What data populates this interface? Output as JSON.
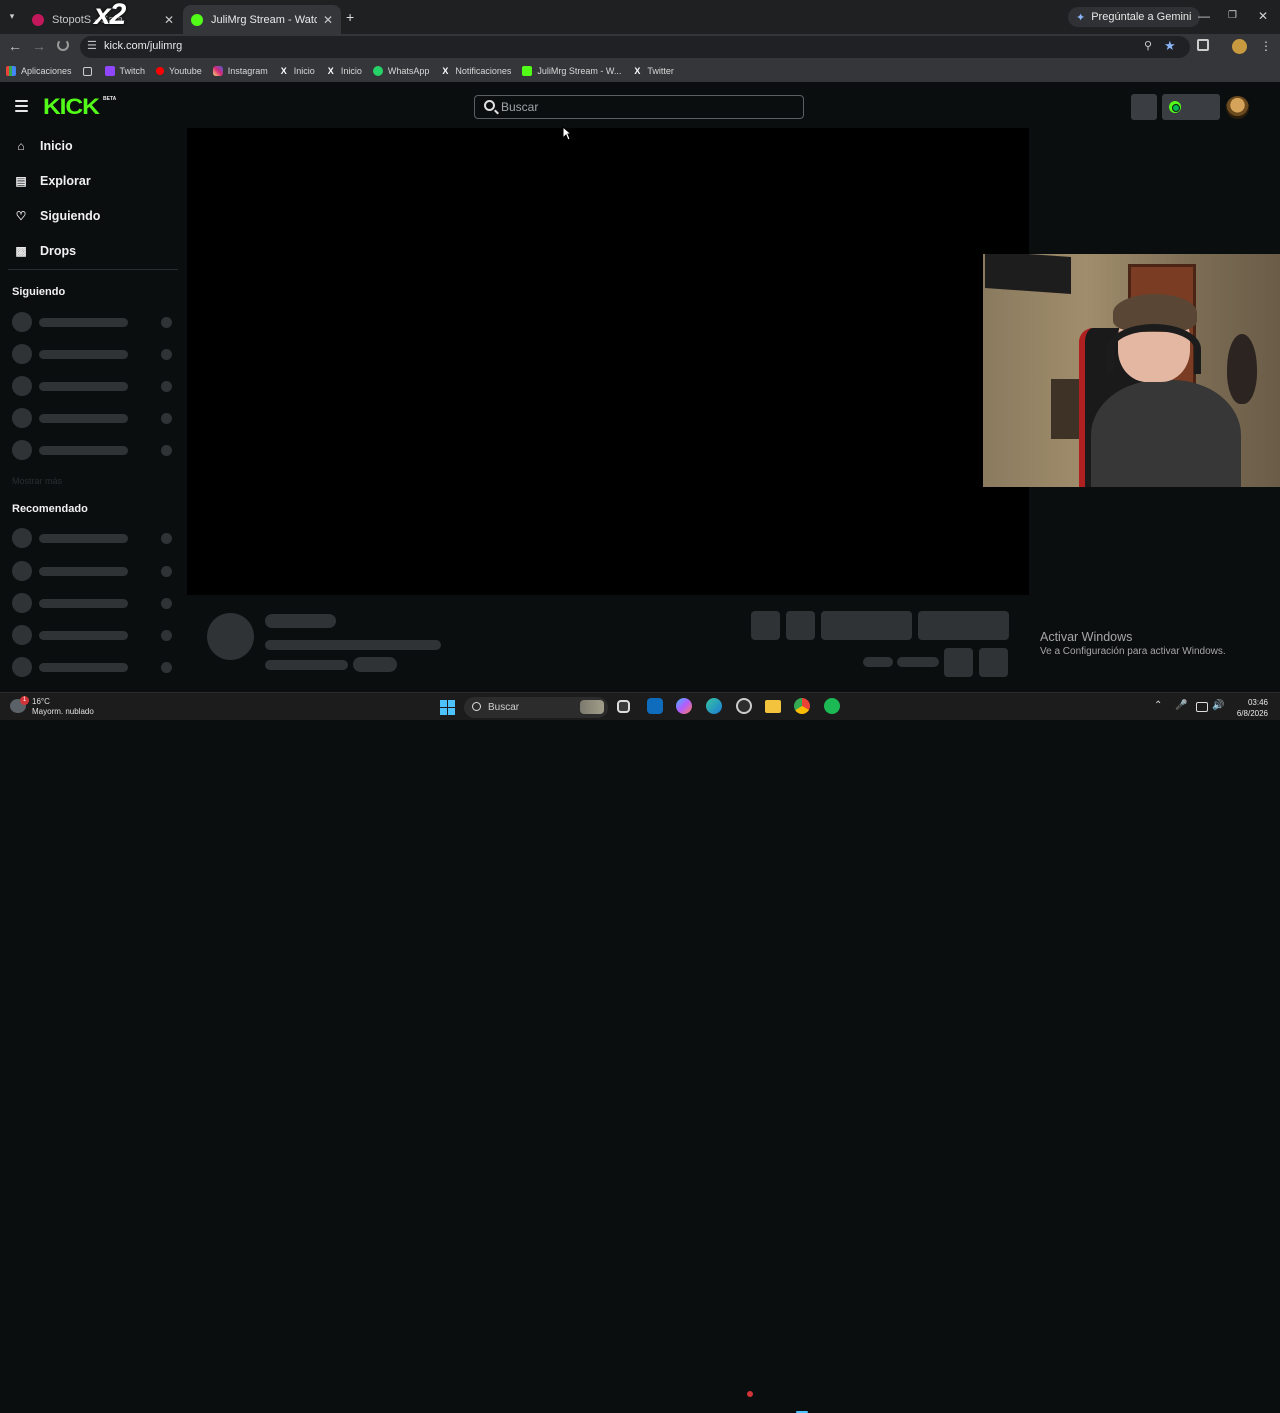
{
  "browser": {
    "tabs": [
      {
        "title": "StopotS - Sala",
        "active": false,
        "favicon_color": "#c2185b"
      },
      {
        "title": "JuliMrg Stream - Watch Live on",
        "active": true,
        "favicon_color": "#53fc18"
      }
    ],
    "overlay_text": "x2",
    "gemini_label": "Pregúntale a Gemini",
    "url": "kick.com/julimrg",
    "bookmarks": [
      {
        "label": "Aplicaciones",
        "icon": "apps-grid-icon"
      },
      {
        "label": "",
        "icon": "tab-groups-icon"
      },
      {
        "label": "Twitch",
        "icon": "twitch-icon"
      },
      {
        "label": "Youtube",
        "icon": "youtube-icon"
      },
      {
        "label": "Instagram",
        "icon": "instagram-icon"
      },
      {
        "label": "Inicio",
        "icon": "x-icon"
      },
      {
        "label": "Inicio",
        "icon": "x-icon"
      },
      {
        "label": "WhatsApp",
        "icon": "whatsapp-icon"
      },
      {
        "label": "Notificaciones",
        "icon": "x-icon"
      },
      {
        "label": "JuliMrg Stream - W...",
        "icon": "kick-icon"
      },
      {
        "label": "Twitter",
        "icon": "x-icon"
      }
    ]
  },
  "kick": {
    "logo_text": "KICK",
    "beta_label": "BETA",
    "search_placeholder": "Buscar",
    "nav": [
      {
        "label": "Inicio",
        "icon": "home-icon"
      },
      {
        "label": "Explorar",
        "icon": "explore-icon"
      },
      {
        "label": "Siguiendo",
        "icon": "heart-icon"
      },
      {
        "label": "Drops",
        "icon": "drops-icon"
      }
    ],
    "following_title": "Siguiendo",
    "show_more_label": "Mostrar más",
    "recommended_title": "Recomendado",
    "accent": "#53fc18"
  },
  "windows": {
    "activate_title": "Activar Windows",
    "activate_sub": "Ve a Configuración para activar Windows.",
    "weather_temp": "16°C",
    "weather_desc": "Mayorm. nublado",
    "weather_badge": "1",
    "search_label": "Buscar",
    "time": "03:46",
    "date": "6/8/2026"
  }
}
